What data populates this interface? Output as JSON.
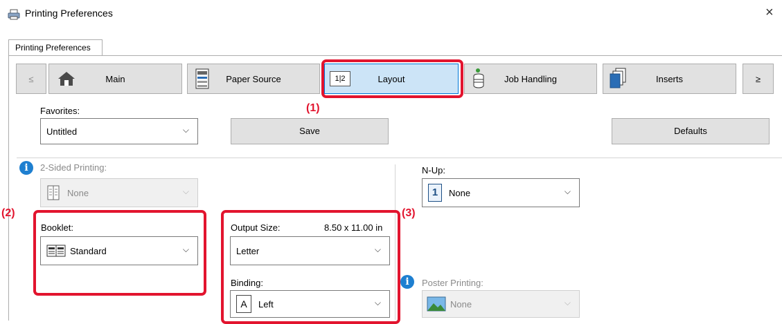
{
  "window": {
    "title": "Printing Preferences",
    "close_glyph": "×",
    "tab": "Printing Preferences"
  },
  "nav": {
    "prev": "≤",
    "next": "≥",
    "items": [
      {
        "label": "Main",
        "icon": "home-icon"
      },
      {
        "label": "Paper Source",
        "icon": "paper-tray-icon"
      },
      {
        "label": "Layout",
        "icon": "layout-pages-icon",
        "icon_text": "1|2"
      },
      {
        "label": "Job Handling",
        "icon": "job-stack-icon"
      },
      {
        "label": "Inserts",
        "icon": "inserts-icon"
      }
    ]
  },
  "favorites": {
    "label": "Favorites:",
    "value": "Untitled",
    "save_label": "Save",
    "defaults_label": "Defaults"
  },
  "two_sided": {
    "label": "2-Sided Printing:",
    "value": "None"
  },
  "nup": {
    "label": "N-Up:",
    "value": "None",
    "icon_text": "1"
  },
  "booklet": {
    "label": "Booklet:",
    "value": "Standard"
  },
  "output_size": {
    "label": "Output Size:",
    "dimensions": "8.50 x 11.00 in",
    "value": "Letter"
  },
  "binding": {
    "label": "Binding:",
    "value": "Left",
    "icon_text": "A"
  },
  "poster": {
    "label": "Poster Printing:",
    "value": "None"
  },
  "callouts": {
    "one": "(1)",
    "two": "(2)",
    "three": "(3)"
  },
  "colors": {
    "highlight": "#e2142e",
    "active_tab": "#cce4f7",
    "info": "#1e7fd0"
  }
}
